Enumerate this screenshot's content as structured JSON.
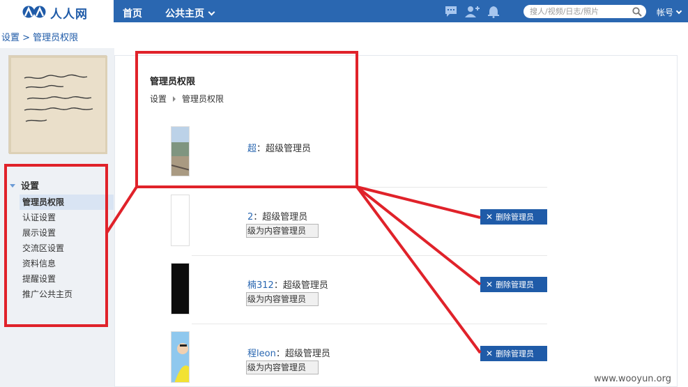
{
  "header": {
    "logo_text": "人人网",
    "nav_home": "首页",
    "nav_public": "公共主页",
    "search_placeholder": "搜人/视频/日志/照片",
    "account": "帐号"
  },
  "breadcrumb_top": "设置 > 管理员权限",
  "sidebar": {
    "heading": "设置",
    "items": [
      {
        "label": "管理员权限"
      },
      {
        "label": "认证设置"
      },
      {
        "label": "展示设置"
      },
      {
        "label": "交流区设置"
      },
      {
        "label": "资料信息"
      },
      {
        "label": "提醒设置"
      },
      {
        "label": "推广公共主页"
      }
    ]
  },
  "main": {
    "title": "管理员权限",
    "crumb_settings": "设置",
    "crumb_current": "管理员权限",
    "admins": [
      {
        "name": "超",
        "role": "：超级管理员"
      },
      {
        "name": "2",
        "role": "：超级管理员",
        "demote_label": "降级为内容管理员",
        "delete_label": "删除管理员"
      },
      {
        "name": "楠312",
        "role": "：超级管理员",
        "demote_label": "降级为内容管理员",
        "delete_label": "删除管理员"
      },
      {
        "name": "程leon",
        "role": "：超级管理员",
        "demote_label": "降级为内容管理员",
        "delete_label": "删除管理员"
      }
    ]
  },
  "annotation_color": "#e0222a",
  "brand_color": "#2a67b1",
  "icons": [
    "chat-icon",
    "add-friend-icon",
    "bell-icon",
    "search-icon",
    "chevron-down-icon"
  ],
  "watermark": "www.wooyun.org"
}
